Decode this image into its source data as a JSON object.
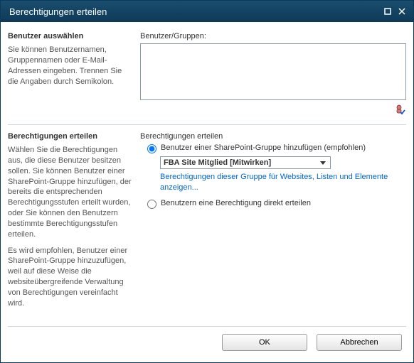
{
  "dialog": {
    "title": "Berechtigungen erteilen"
  },
  "section1": {
    "heading": "Benutzer auswählen",
    "desc": "Sie können Benutzernamen, Gruppennamen oder E-Mail-Adressen eingeben. Trennen Sie die Angaben durch Semikolon.",
    "label": "Benutzer/Gruppen:",
    "value": ""
  },
  "section2": {
    "heading": "Berechtigungen erteilen",
    "desc1": "Wählen Sie die Berechtigungen aus, die diese Benutzer besitzen sollen. Sie können Benutzer einer SharePoint-Gruppe hinzufügen, der bereits die entsprechenden Berechtigungsstufen erteilt wurden, oder Sie können den Benutzern bestimmte Berechtigungsstufen erteilen.",
    "desc2": "Es wird empfohlen, Benutzer einer SharePoint-Gruppe hinzuzufügen, weil auf diese Weise die websiteübergreifende Verwaltung von Berechtigungen vereinfacht wird.",
    "label": "Berechtigungen erteilen",
    "radio1": "Benutzer einer SharePoint-Gruppe hinzufügen (empfohlen)",
    "select_value": "FBA Site Mitglied [Mitwirken]",
    "link": "Berechtigungen dieser Gruppe für Websites, Listen und Elemente anzeigen...",
    "radio2": "Benutzern eine Berechtigung direkt erteilen"
  },
  "buttons": {
    "ok": "OK",
    "cancel": "Abbrechen"
  }
}
